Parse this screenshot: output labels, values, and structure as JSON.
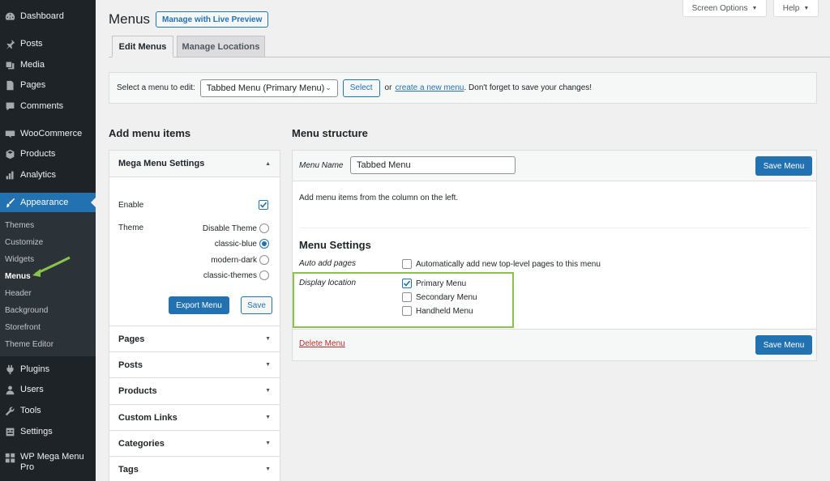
{
  "sidebar": {
    "items": [
      {
        "label": "Dashboard",
        "icon": "dashboard-icon"
      },
      {
        "label": "Posts",
        "icon": "pin-icon"
      },
      {
        "label": "Media",
        "icon": "media-icon"
      },
      {
        "label": "Pages",
        "icon": "page-icon"
      },
      {
        "label": "Comments",
        "icon": "comment-icon"
      },
      {
        "label": "WooCommerce",
        "icon": "woocommerce-icon"
      },
      {
        "label": "Products",
        "icon": "box-icon"
      },
      {
        "label": "Analytics",
        "icon": "bar-chart-icon"
      },
      {
        "label": "Appearance",
        "icon": "brush-icon"
      },
      {
        "label": "Plugins",
        "icon": "plug-icon"
      },
      {
        "label": "Users",
        "icon": "user-icon"
      },
      {
        "label": "Tools",
        "icon": "wrench-icon"
      },
      {
        "label": "Settings",
        "icon": "sliders-icon"
      },
      {
        "label": "WP Mega Menu",
        "label2": "Pro",
        "icon": "grid-icon"
      }
    ],
    "submenu": [
      "Themes",
      "Customize",
      "Widgets",
      "Menus",
      "Header",
      "Background",
      "Storefront",
      "Theme Editor"
    ],
    "accent": "#2271b1"
  },
  "top": {
    "screen_options": "Screen Options",
    "help": "Help"
  },
  "header": {
    "title": "Menus",
    "live_preview": "Manage with Live Preview"
  },
  "tabs": [
    {
      "label": "Edit Menus"
    },
    {
      "label": "Manage Locations"
    }
  ],
  "select_bar": {
    "label": "Select a menu to edit:",
    "selected": "Tabbed Menu (Primary Menu)",
    "select_button": "Select",
    "or": "or",
    "create_link": "create a new menu",
    "note": ". Don't forget to save your changes!"
  },
  "left": {
    "heading": "Add menu items",
    "mega": {
      "title": "Mega Menu Settings",
      "enable_label": "Enable",
      "enable_checked": true,
      "theme_label": "Theme",
      "themes": [
        "Disable Theme",
        "classic-blue",
        "modern-dark",
        "classic-themes"
      ],
      "selected_theme": "classic-blue",
      "export_button": "Export Menu",
      "save_button": "Save"
    },
    "accordion": [
      "Pages",
      "Posts",
      "Products",
      "Custom Links",
      "Categories",
      "Tags"
    ]
  },
  "right": {
    "heading": "Menu structure",
    "menu_name_label": "Menu Name",
    "menu_name_value": "Tabbed Menu",
    "save_button": "Save Menu",
    "instructions": "Add menu items from the column on the left.",
    "settings_title": "Menu Settings",
    "auto_add_label": "Auto add pages",
    "auto_add_text": "Automatically add new top-level pages to this menu",
    "display_location_label": "Display location",
    "locations": [
      {
        "label": "Primary Menu",
        "checked": true
      },
      {
        "label": "Secondary Menu",
        "checked": false
      },
      {
        "label": "Handheld Menu",
        "checked": false
      }
    ],
    "delete_link": "Delete Menu",
    "highlight_color": "#8bc34a"
  }
}
